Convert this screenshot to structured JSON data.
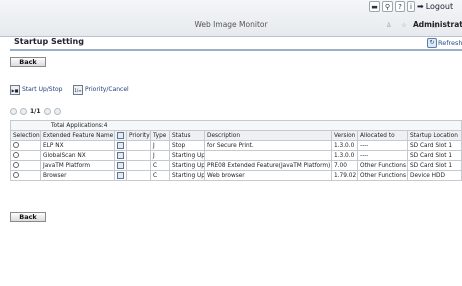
{
  "header": {
    "app_name": "Web Image Monitor",
    "logout_label": "Logout",
    "user": "Administrator",
    "icons": [
      "keyboard-icon",
      "search-icon",
      "help-icon",
      "info-icon"
    ],
    "small_icons": "♙ ☆ ⊥ ▤"
  },
  "page": {
    "title": "Startup Setting",
    "refresh_label": "Refresh",
    "back_label": "Back"
  },
  "toolbar": {
    "start_stop_label": "Start Up/Stop",
    "priority_label": "Priority/Cancel"
  },
  "pager": {
    "text": "1/1"
  },
  "table": {
    "total_label": "Total Applications:4",
    "columns": [
      "Selection",
      "Extended Feature Name",
      "",
      "Priority",
      "Type",
      "Status",
      "Description",
      "Version",
      "Allocated to",
      "Startup Location"
    ],
    "rows": [
      {
        "name": "ELP NX",
        "priority": "",
        "type": "J",
        "status": "Stop",
        "description": "for Secure Print.",
        "version": "1.3.0.0",
        "allocated": "----",
        "location": "SD Card Slot 1"
      },
      {
        "name": "GlobalScan NX",
        "priority": "",
        "type": "J",
        "status": "Starting Up",
        "description": "",
        "version": "1.3.0.0",
        "allocated": "----",
        "location": "SD Card Slot 1"
      },
      {
        "name": "JavaTM Platform",
        "priority": "",
        "type": "C",
        "status": "Starting Up",
        "description": "PRE08 Extended Feature(JavaTM Platform)",
        "version": "7.00",
        "allocated": "Other Functions",
        "location": "SD Card Slot 1"
      },
      {
        "name": "Browser",
        "priority": "",
        "type": "C",
        "status": "Starting Up",
        "description": "Web browser",
        "version": "1.79.02",
        "allocated": "Other Functions",
        "location": "Device HDD"
      }
    ]
  }
}
